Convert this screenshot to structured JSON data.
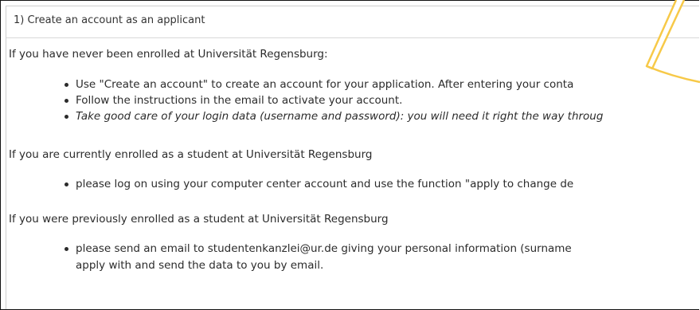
{
  "heading": "1) Create an account as an applicant",
  "section_new": {
    "intro": "If you have never been enrolled at Universität Regensburg:",
    "items": [
      "Use \"Create an account\" to create an account for your application. After entering your conta",
      "Follow the instructions in the email to activate your account.",
      "Take good care of your login data (username and password): you will need it right the way throug"
    ]
  },
  "section_current": {
    "intro": "If you are currently enrolled as a student at Universität Regensburg",
    "items": [
      "please log on using your computer center account and use the function \"apply to change de"
    ]
  },
  "section_previous": {
    "intro": "If you were previously enrolled as a student at Universität Regensburg",
    "items": [
      "please send an email to studentenkanzlei@ur.de giving your personal information (surname"
    ],
    "continuation": "apply with and send the data to you by email."
  },
  "colors": {
    "callout": "#f7c948",
    "border": "#111111",
    "text": "#2b2b2b"
  }
}
